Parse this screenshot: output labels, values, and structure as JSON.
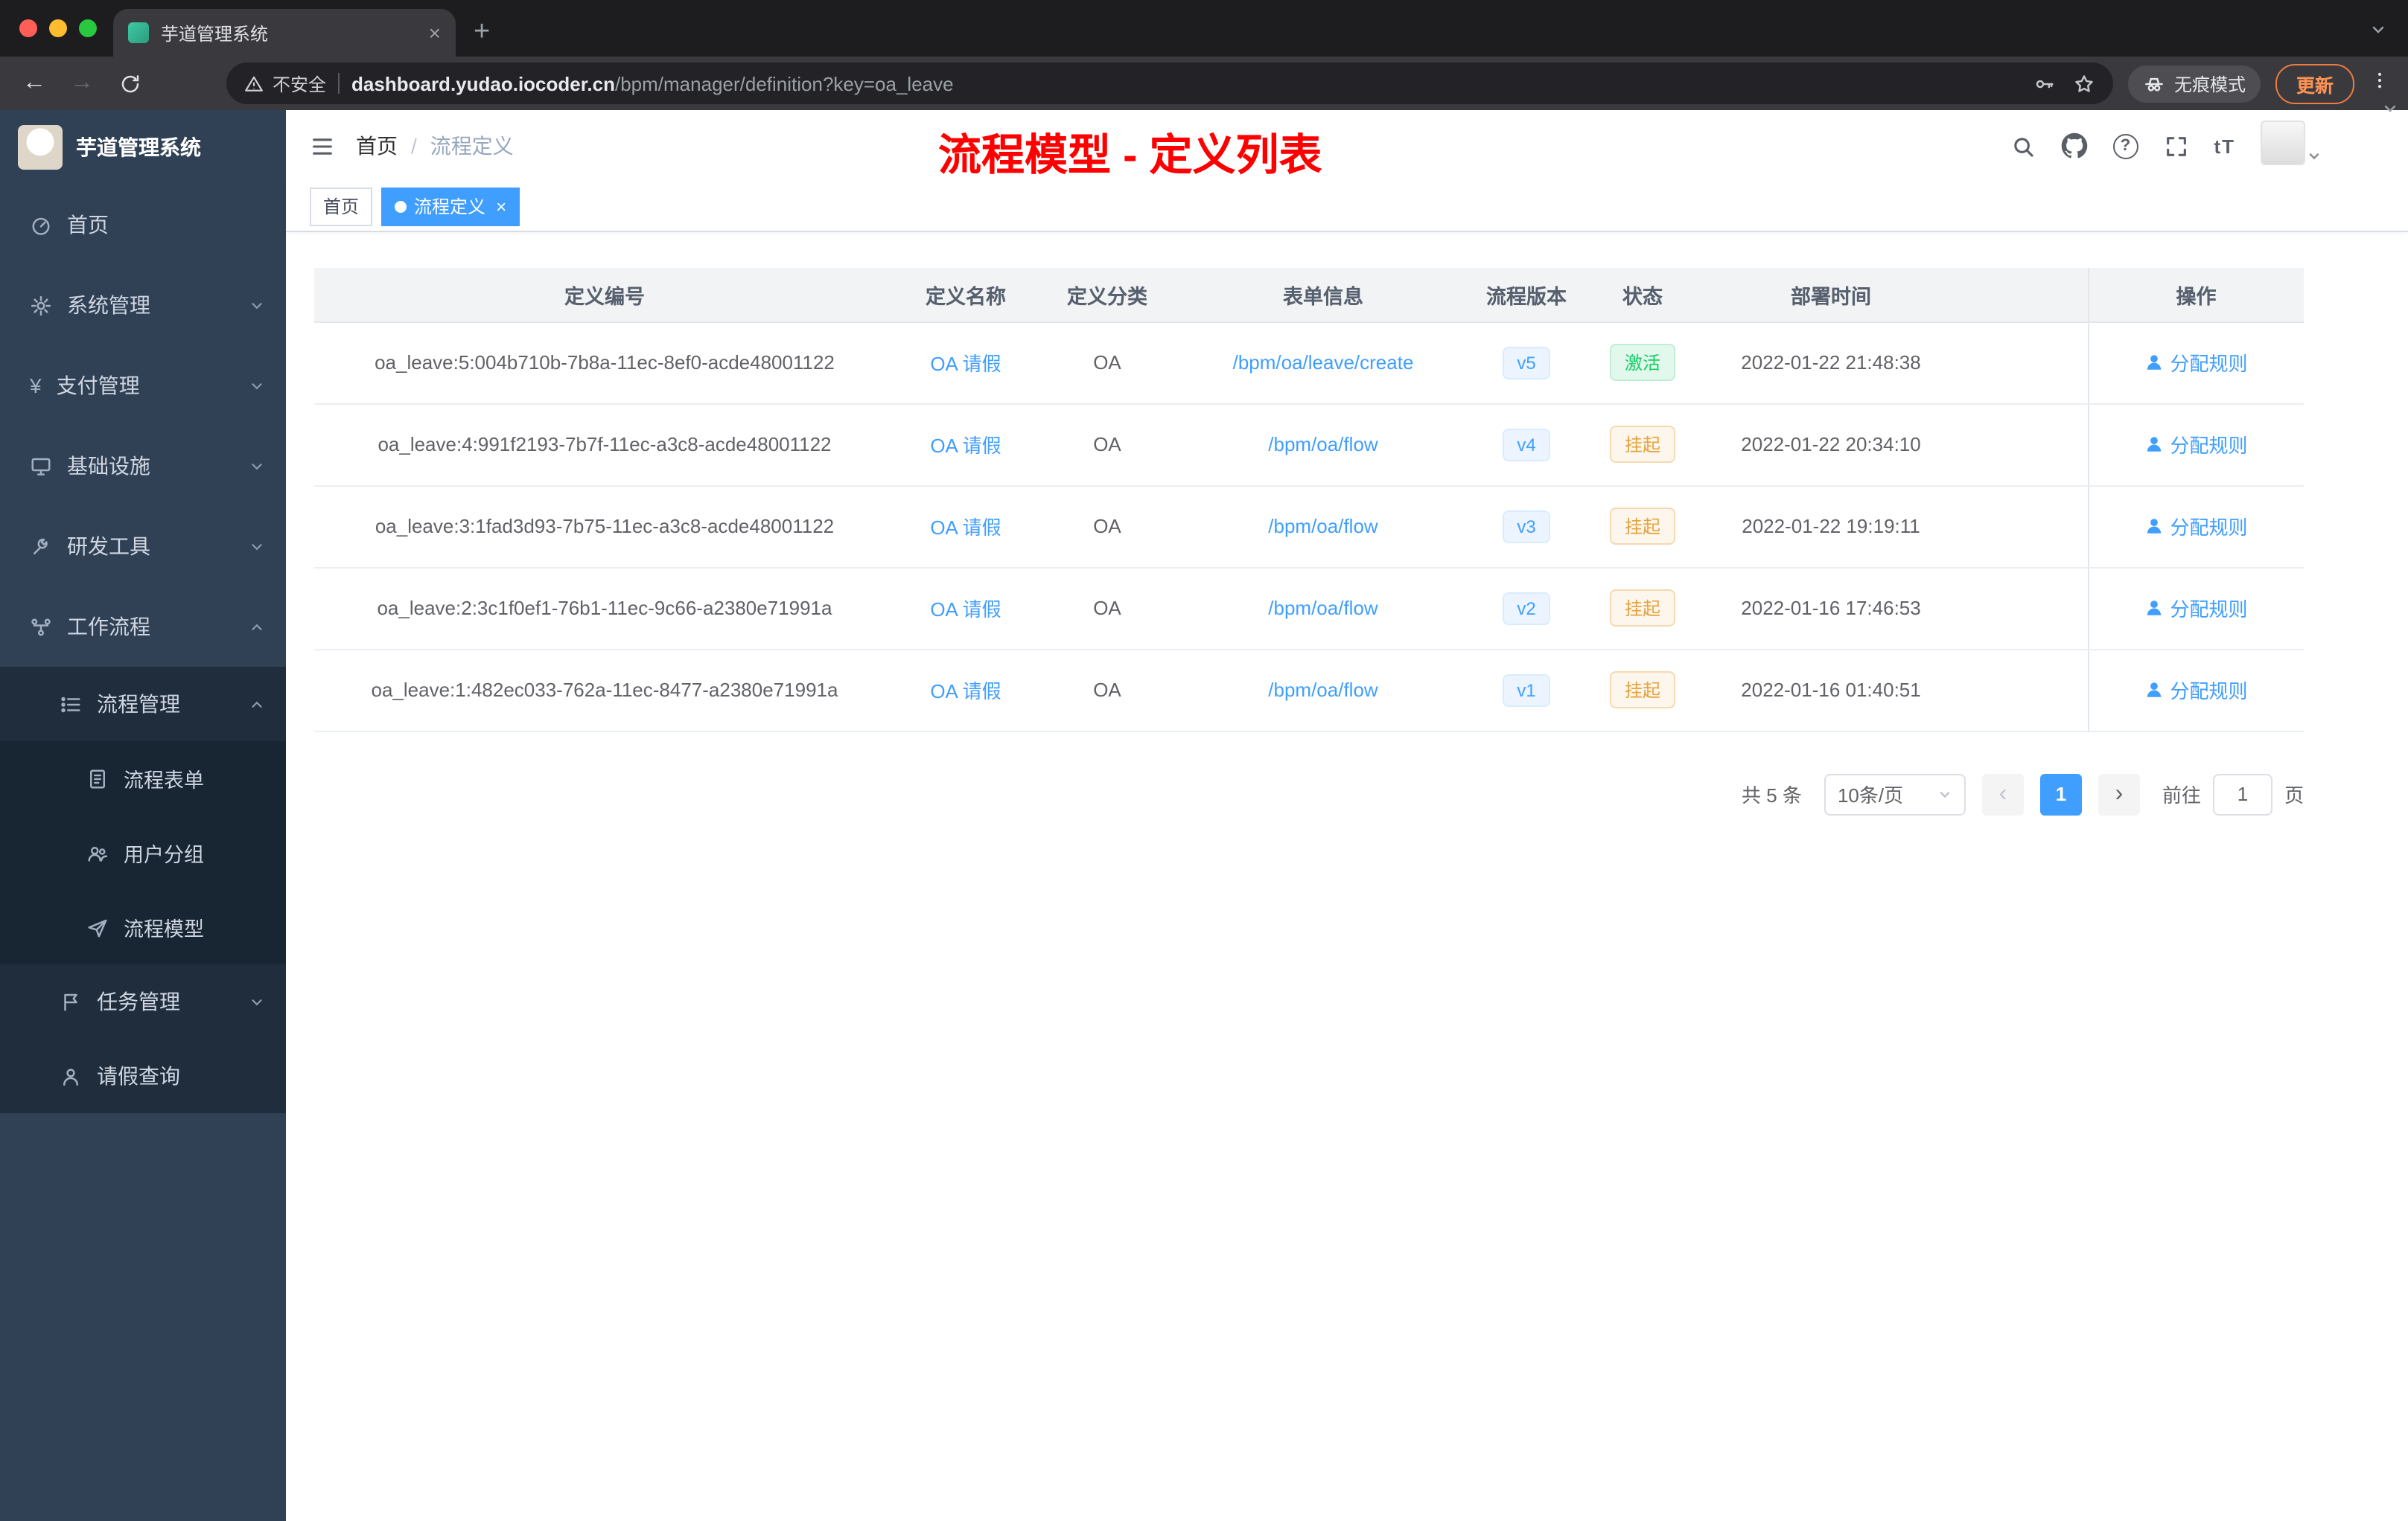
{
  "colors": {
    "accent": "#409eff",
    "success": "#13ce66",
    "warning": "#e6a23c",
    "annotation_red": "#ff0000",
    "sidebar_bg": "#304156",
    "sidebar_sub_bg": "#1f2d3d"
  },
  "glyphs": {
    "close": "×",
    "plus": "+"
  },
  "browser": {
    "tab_title": "芋道管理系统",
    "security_label": "不安全",
    "url_domain": "dashboard.yudao.iocoder.cn",
    "url_path": "/bpm/manager/definition?key=oa_leave",
    "incognito_label": "无痕模式",
    "update_label": "更新"
  },
  "sidebar": {
    "logo_title": "芋道管理系统",
    "items": [
      {
        "label": "首页"
      },
      {
        "label": "系统管理"
      },
      {
        "label": "支付管理"
      },
      {
        "label": "基础设施"
      },
      {
        "label": "研发工具"
      },
      {
        "label": "工作流程"
      },
      {
        "label": "流程管理"
      },
      {
        "label": "流程表单"
      },
      {
        "label": "用户分组"
      },
      {
        "label": "流程模型"
      },
      {
        "label": "任务管理"
      },
      {
        "label": "请假查询"
      }
    ]
  },
  "header": {
    "breadcrumb_home": "首页",
    "breadcrumb_sep": "/",
    "breadcrumb_current": "流程定义",
    "annotation": "流程模型 - 定义列表"
  },
  "tags": {
    "first": "首页",
    "active": "流程定义"
  },
  "table": {
    "columns": [
      "定义编号",
      "定义名称",
      "定义分类",
      "表单信息",
      "流程版本",
      "状态",
      "部署时间",
      "操作"
    ],
    "rows": [
      {
        "id": "oa_leave:5:004b710b-7b8a-11ec-8ef0-acde48001122",
        "name": "OA 请假",
        "category": "OA",
        "form": "/bpm/oa/leave/create",
        "version": "v5",
        "status": "激活",
        "time": "2022-01-22 21:48:38",
        "action": "分配规则"
      },
      {
        "id": "oa_leave:4:991f2193-7b7f-11ec-a3c8-acde48001122",
        "name": "OA 请假",
        "category": "OA",
        "form": "/bpm/oa/flow",
        "version": "v4",
        "status": "挂起",
        "time": "2022-01-22 20:34:10",
        "action": "分配规则"
      },
      {
        "id": "oa_leave:3:1fad3d93-7b75-11ec-a3c8-acde48001122",
        "name": "OA 请假",
        "category": "OA",
        "form": "/bpm/oa/flow",
        "version": "v3",
        "status": "挂起",
        "time": "2022-01-22 19:19:11",
        "action": "分配规则"
      },
      {
        "id": "oa_leave:2:3c1f0ef1-76b1-11ec-9c66-a2380e71991a",
        "name": "OA 请假",
        "category": "OA",
        "form": "/bpm/oa/flow",
        "version": "v2",
        "status": "挂起",
        "time": "2022-01-16 17:46:53",
        "action": "分配规则"
      },
      {
        "id": "oa_leave:1:482ec033-762a-11ec-8477-a2380e71991a",
        "name": "OA 请假",
        "category": "OA",
        "form": "/bpm/oa/flow",
        "version": "v1",
        "status": "挂起",
        "time": "2022-01-16 01:40:51",
        "action": "分配规则"
      }
    ]
  },
  "pagination": {
    "total": "共 5 条",
    "page_size": "10条/页",
    "prev": "‹",
    "page": "1",
    "next": "›",
    "goto_prefix": "前往",
    "goto_value": "1",
    "goto_suffix": "页"
  }
}
